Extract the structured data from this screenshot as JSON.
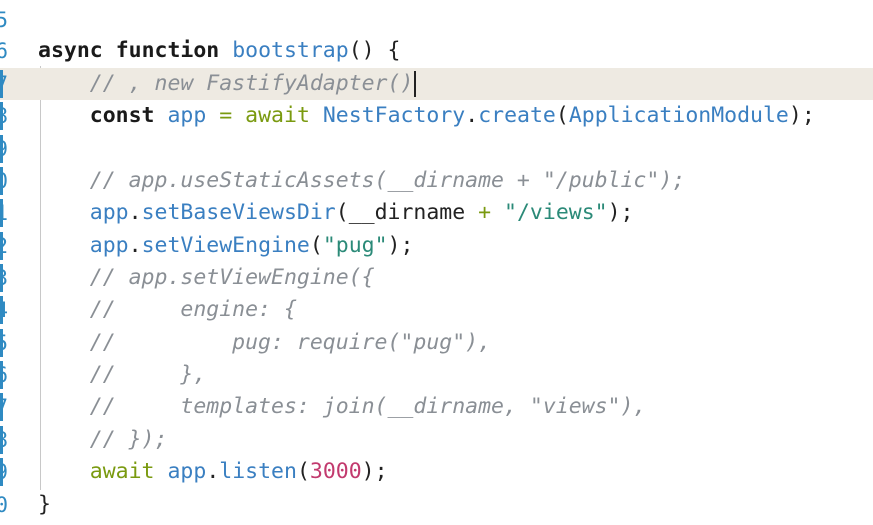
{
  "editor": {
    "line_numbers": [
      "5",
      "6",
      "7",
      "8",
      "9",
      "0",
      "1",
      "2",
      "3",
      "4",
      "5",
      "6",
      "7",
      "8",
      "9",
      "0"
    ],
    "lines": [
      {
        "segments": []
      },
      {
        "segments": [
          {
            "t": "async",
            "c": "kw"
          },
          {
            "t": " ",
            "c": "plain"
          },
          {
            "t": "function",
            "c": "kw"
          },
          {
            "t": " ",
            "c": "plain"
          },
          {
            "t": "bootstrap",
            "c": "fn"
          },
          {
            "t": "() {",
            "c": "plain"
          }
        ]
      },
      {
        "segments": [
          {
            "t": "    // , new FastifyAdapter()",
            "c": "cmt"
          }
        ],
        "current": true
      },
      {
        "segments": [
          {
            "t": "    ",
            "c": "plain"
          },
          {
            "t": "const",
            "c": "kw"
          },
          {
            "t": " ",
            "c": "plain"
          },
          {
            "t": "app",
            "c": "var"
          },
          {
            "t": " ",
            "c": "plain"
          },
          {
            "t": "=",
            "c": "op"
          },
          {
            "t": " ",
            "c": "plain"
          },
          {
            "t": "await",
            "c": "aw"
          },
          {
            "t": " ",
            "c": "plain"
          },
          {
            "t": "NestFactory",
            "c": "cls"
          },
          {
            "t": ".",
            "c": "plain"
          },
          {
            "t": "create",
            "c": "fn"
          },
          {
            "t": "(",
            "c": "plain"
          },
          {
            "t": "ApplicationModule",
            "c": "cls"
          },
          {
            "t": ");",
            "c": "plain"
          }
        ]
      },
      {
        "segments": []
      },
      {
        "segments": [
          {
            "t": "    // app.useStaticAssets(__dirname + \"/public\");",
            "c": "cmt"
          }
        ]
      },
      {
        "segments": [
          {
            "t": "    ",
            "c": "plain"
          },
          {
            "t": "app",
            "c": "var"
          },
          {
            "t": ".",
            "c": "plain"
          },
          {
            "t": "setBaseViewsDir",
            "c": "fn"
          },
          {
            "t": "(__dirname ",
            "c": "plain"
          },
          {
            "t": "+",
            "c": "op"
          },
          {
            "t": " ",
            "c": "plain"
          },
          {
            "t": "\"/views\"",
            "c": "str"
          },
          {
            "t": ");",
            "c": "plain"
          }
        ]
      },
      {
        "segments": [
          {
            "t": "    ",
            "c": "plain"
          },
          {
            "t": "app",
            "c": "var"
          },
          {
            "t": ".",
            "c": "plain"
          },
          {
            "t": "setViewEngine",
            "c": "fn"
          },
          {
            "t": "(",
            "c": "plain"
          },
          {
            "t": "\"pug\"",
            "c": "str"
          },
          {
            "t": ");",
            "c": "plain"
          }
        ]
      },
      {
        "segments": [
          {
            "t": "    // app.setViewEngine({",
            "c": "cmt"
          }
        ]
      },
      {
        "segments": [
          {
            "t": "    //     engine: {",
            "c": "cmt"
          }
        ]
      },
      {
        "segments": [
          {
            "t": "    //         pug: require(\"pug\"),",
            "c": "cmt"
          }
        ]
      },
      {
        "segments": [
          {
            "t": "    //     },",
            "c": "cmt"
          }
        ]
      },
      {
        "segments": [
          {
            "t": "    //     templates: join(__dirname, \"views\"),",
            "c": "cmt"
          }
        ]
      },
      {
        "segments": [
          {
            "t": "    // });",
            "c": "cmt"
          }
        ]
      },
      {
        "segments": [
          {
            "t": "    ",
            "c": "plain"
          },
          {
            "t": "await",
            "c": "aw"
          },
          {
            "t": " ",
            "c": "plain"
          },
          {
            "t": "app",
            "c": "var"
          },
          {
            "t": ".",
            "c": "plain"
          },
          {
            "t": "listen",
            "c": "fn"
          },
          {
            "t": "(",
            "c": "plain"
          },
          {
            "t": "3000",
            "c": "num"
          },
          {
            "t": ");",
            "c": "plain"
          }
        ]
      },
      {
        "segments": [
          {
            "t": "}",
            "c": "plain"
          }
        ]
      }
    ]
  }
}
